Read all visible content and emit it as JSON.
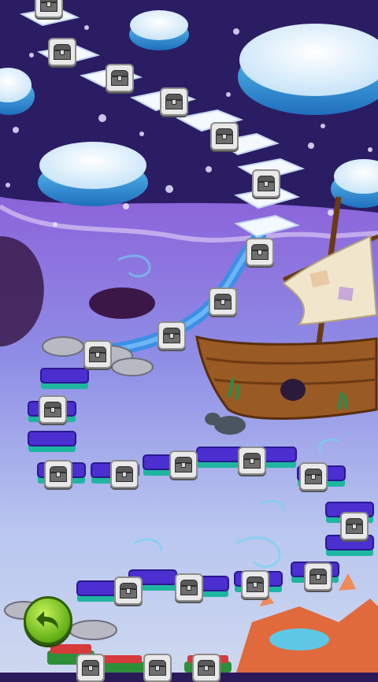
{
  "screen": {
    "name": "level-map"
  },
  "level_nodes": [
    {
      "id": "node-1",
      "state": "locked",
      "icon": "treasure-chest-icon"
    },
    {
      "id": "node-2",
      "state": "locked",
      "icon": "treasure-chest-icon"
    },
    {
      "id": "node-3",
      "state": "locked",
      "icon": "treasure-chest-icon"
    },
    {
      "id": "node-4",
      "state": "locked",
      "icon": "treasure-chest-icon"
    },
    {
      "id": "node-5",
      "state": "locked",
      "icon": "treasure-chest-icon"
    },
    {
      "id": "node-6",
      "state": "locked",
      "icon": "treasure-chest-icon"
    },
    {
      "id": "node-7",
      "state": "locked",
      "icon": "treasure-chest-icon"
    },
    {
      "id": "node-8",
      "state": "locked",
      "icon": "treasure-chest-icon"
    },
    {
      "id": "node-9",
      "state": "locked",
      "icon": "treasure-chest-icon"
    },
    {
      "id": "node-10",
      "state": "locked",
      "icon": "treasure-chest-icon"
    },
    {
      "id": "node-11",
      "state": "locked",
      "icon": "treasure-chest-icon"
    },
    {
      "id": "node-12",
      "state": "locked",
      "icon": "treasure-chest-icon"
    },
    {
      "id": "node-13",
      "state": "locked",
      "icon": "treasure-chest-icon"
    },
    {
      "id": "node-14",
      "state": "locked",
      "icon": "treasure-chest-icon"
    },
    {
      "id": "node-15",
      "state": "locked",
      "icon": "treasure-chest-icon"
    },
    {
      "id": "node-16",
      "state": "locked",
      "icon": "treasure-chest-icon"
    },
    {
      "id": "node-17",
      "state": "locked",
      "icon": "treasure-chest-icon"
    },
    {
      "id": "node-18",
      "state": "locked",
      "icon": "treasure-chest-icon"
    },
    {
      "id": "node-19",
      "state": "locked",
      "icon": "treasure-chest-icon"
    },
    {
      "id": "node-20",
      "state": "locked",
      "icon": "treasure-chest-icon"
    },
    {
      "id": "node-21",
      "state": "locked",
      "icon": "treasure-chest-icon"
    },
    {
      "id": "node-22",
      "state": "locked",
      "icon": "treasure-chest-icon"
    },
    {
      "id": "node-23",
      "state": "locked",
      "icon": "treasure-chest-icon"
    },
    {
      "id": "node-24",
      "state": "locked",
      "icon": "treasure-chest-icon"
    }
  ],
  "back_button": {
    "icon": "back-arrow-icon"
  },
  "colors": {
    "night_sky": "#2b1d63",
    "ice": "#f4f8ff",
    "ice_edge": "#3a8fd6",
    "sea_top": "#9a6fe0",
    "sea_bottom": "#c6d4ee",
    "river": "#3d8fe6",
    "ship_wood": "#9a5a24",
    "sail": "#efe6cc",
    "tile_purple": "#4b2fd0",
    "tile_teal": "#1fb6a1",
    "back_green": "#6cc21c"
  }
}
